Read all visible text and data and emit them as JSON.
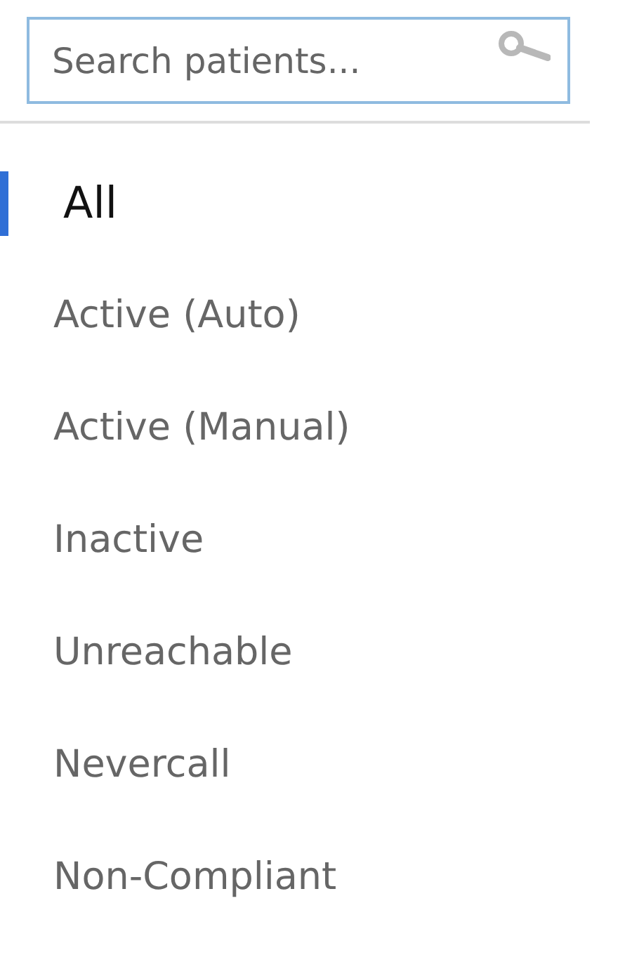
{
  "search": {
    "placeholder": "Search patients..."
  },
  "filters": [
    {
      "label": "All",
      "selected": true
    },
    {
      "label": "Active (Auto)",
      "selected": false
    },
    {
      "label": "Active (Manual)",
      "selected": false
    },
    {
      "label": "Inactive",
      "selected": false
    },
    {
      "label": "Unreachable",
      "selected": false
    },
    {
      "label": "Nevercall",
      "selected": false
    },
    {
      "label": "Non-Compliant",
      "selected": false
    }
  ]
}
